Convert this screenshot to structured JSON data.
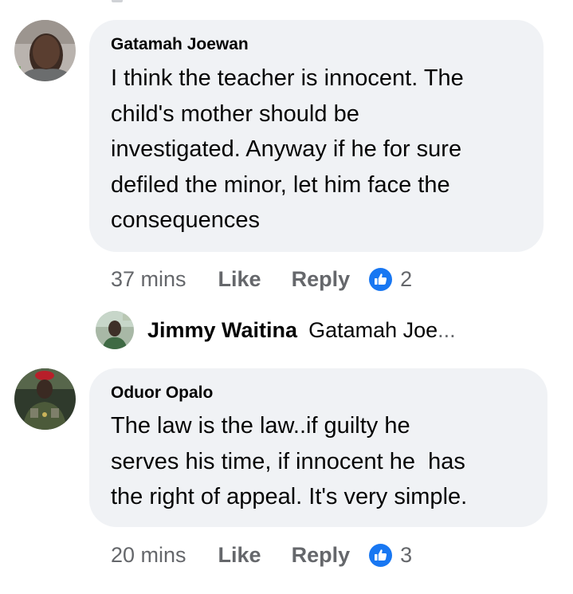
{
  "comments": [
    {
      "author": "Gatamah Joewan",
      "lines": [
        "I think the teacher is innocent. The",
        "child's mother should be",
        "investigated. Anyway if he for sure",
        "defiled the minor, let him face the",
        "consequences"
      ],
      "time": "37 mins",
      "like_label": "Like",
      "reply_label": "Reply",
      "reaction_icon": "like-thumb-icon",
      "reaction_count": "2"
    },
    {
      "author": "Oduor Opalo",
      "lines": [
        "The law is the law..if guilty he",
        "serves his time, if innocent he  has",
        "the right of appeal. It's very simple."
      ],
      "time": "20 mins",
      "like_label": "Like",
      "reply_label": "Reply",
      "reaction_icon": "like-thumb-icon",
      "reaction_count": "3"
    }
  ],
  "reply_preview": {
    "author": "Jimmy Waitina",
    "text": "Gatamah Joe",
    "ellipsis": "..."
  },
  "colors": {
    "bubble": "#f0f2f5",
    "meta_text": "#65676b",
    "like_blue": "#1877f2"
  }
}
